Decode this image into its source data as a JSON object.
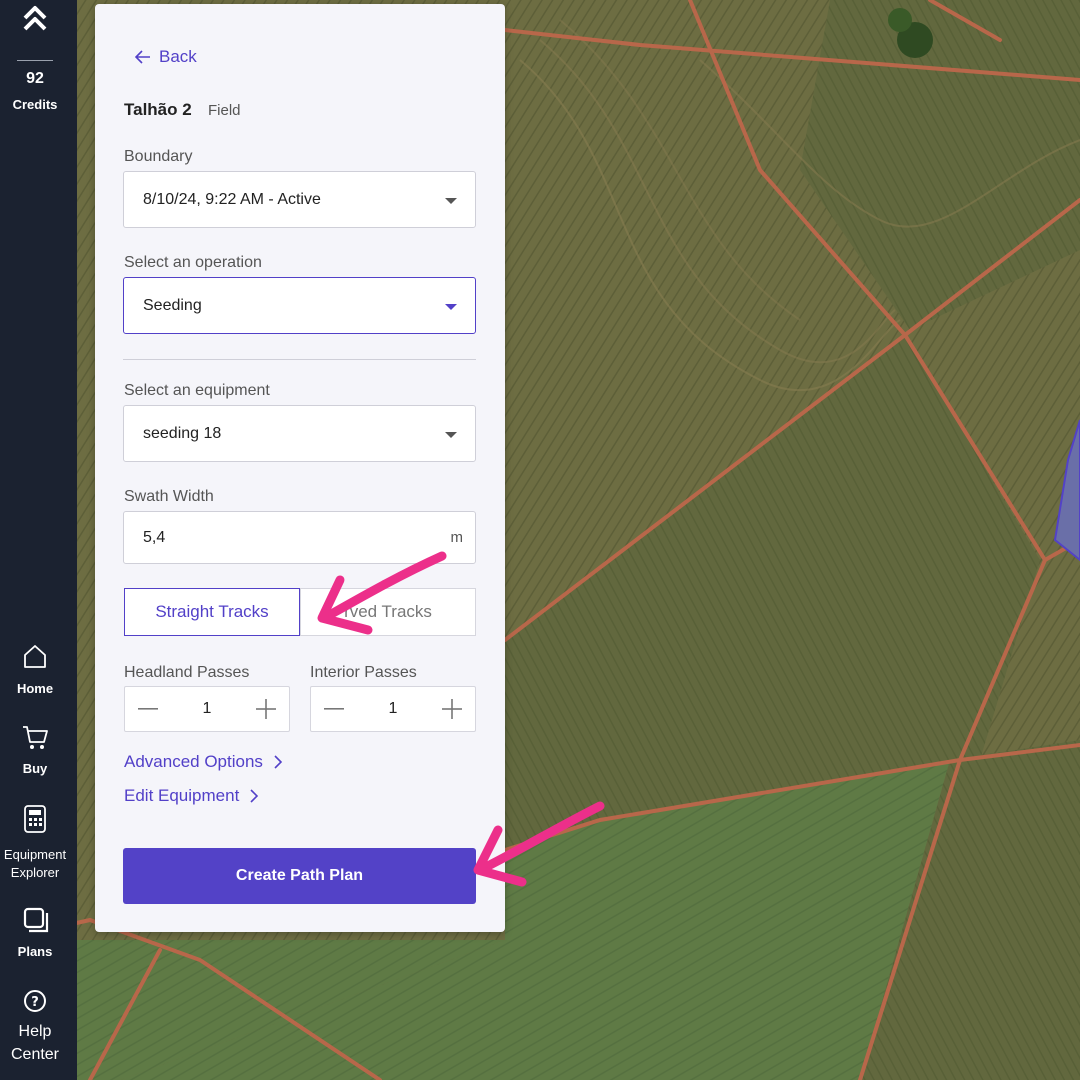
{
  "nav": {
    "credits_count": "92",
    "credits_label": "Credits",
    "items": [
      {
        "label": "Home",
        "icon": "home-icon"
      },
      {
        "label": "Buy",
        "icon": "cart-icon"
      },
      {
        "label_line1": "Equipment",
        "label_line2": "Explorer",
        "icon": "calculator-icon"
      },
      {
        "label": "Plans",
        "icon": "plans-icon"
      },
      {
        "label_line1": "Help",
        "label_line2": "Center",
        "icon": "help-icon"
      }
    ]
  },
  "panel": {
    "back_label": "Back",
    "field_name": "Talhão 2",
    "field_tag": "Field",
    "boundary": {
      "label": "Boundary",
      "value": "8/10/24, 9:22 AM - Active"
    },
    "operation": {
      "label": "Select an operation",
      "value": "Seeding"
    },
    "equipment": {
      "label": "Select an equipment",
      "value": "seeding 18"
    },
    "swath": {
      "label": "Swath Width",
      "value": "5,4",
      "unit": "m"
    },
    "track_options": {
      "straight": "Straight Tracks",
      "curved": "rved Tracks",
      "selected": "straight"
    },
    "headland": {
      "label": "Headland Passes",
      "value": "1"
    },
    "interior": {
      "label": "Interior Passes",
      "value": "1"
    },
    "advanced_label": "Advanced Options",
    "edit_equipment_label": "Edit Equipment",
    "create_label": "Create Path Plan"
  },
  "colors": {
    "accent": "#5342c7",
    "nav_bg": "#1b2230",
    "annotation_arrow": "#ec2f8a"
  }
}
